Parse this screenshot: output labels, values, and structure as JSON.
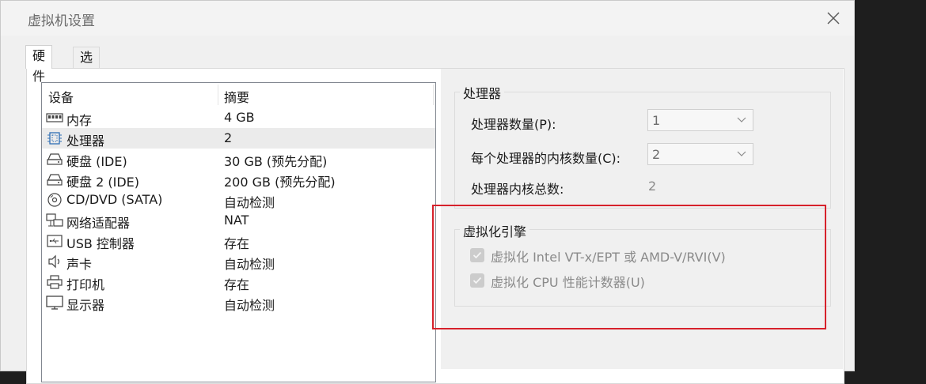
{
  "window": {
    "title": "虚拟机设置",
    "close_icon": "close-icon"
  },
  "tabs": [
    {
      "label": "硬件",
      "active": true
    },
    {
      "label": "选项",
      "active": false
    }
  ],
  "device_list": {
    "columns": [
      "设备",
      "摘要"
    ],
    "rows": [
      {
        "icon": "memory-icon",
        "name": "内存",
        "summary": "4 GB",
        "selected": false
      },
      {
        "icon": "processor-icon",
        "name": "处理器",
        "summary": "2",
        "selected": true
      },
      {
        "icon": "hard-disk-icon",
        "name": "硬盘 (IDE)",
        "summary": "30 GB (预先分配)",
        "selected": false
      },
      {
        "icon": "hard-disk-icon",
        "name": "硬盘 2 (IDE)",
        "summary": "200 GB (预先分配)",
        "selected": false
      },
      {
        "icon": "cd-dvd-icon",
        "name": "CD/DVD (SATA)",
        "summary": "自动检测",
        "selected": false
      },
      {
        "icon": "network-adapter-icon",
        "name": "网络适配器",
        "summary": "NAT",
        "selected": false
      },
      {
        "icon": "usb-icon",
        "name": "USB 控制器",
        "summary": "存在",
        "selected": false
      },
      {
        "icon": "sound-card-icon",
        "name": "声卡",
        "summary": "自动检测",
        "selected": false
      },
      {
        "icon": "printer-icon",
        "name": "打印机",
        "summary": "存在",
        "selected": false
      },
      {
        "icon": "display-icon",
        "name": "显示器",
        "summary": "自动检测",
        "selected": false
      }
    ]
  },
  "processor_group": {
    "title": "处理器",
    "processor_count_label": "处理器数量(P):",
    "processor_count_value": "1",
    "cores_per_processor_label": "每个处理器的内核数量(C):",
    "cores_per_processor_value": "2",
    "total_cores_label": "处理器内核总数:",
    "total_cores_value": "2"
  },
  "virtualization_group": {
    "title": "虚拟化引擎",
    "options": [
      {
        "label": "虚拟化 Intel VT-x/EPT 或 AMD-V/RVI(V)",
        "checked": true,
        "enabled": false
      },
      {
        "label": "虚拟化 CPU 性能计数器(U)",
        "checked": true,
        "enabled": false
      }
    ]
  },
  "colors": {
    "highlight_border": "#d6212b",
    "selected_row": "#ebebeb",
    "disabled_text": "#8a8a8a"
  }
}
